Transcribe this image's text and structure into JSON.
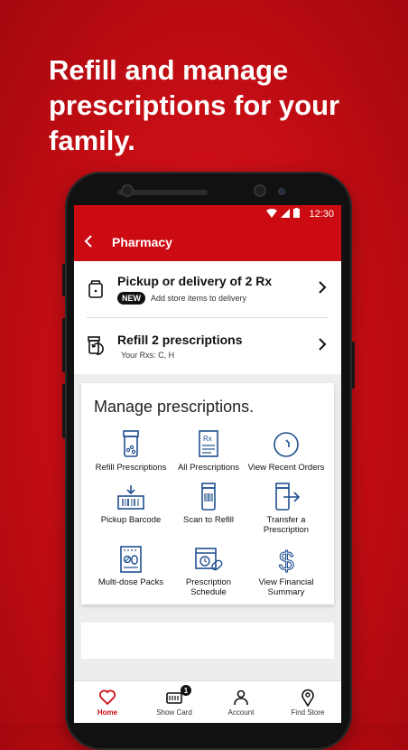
{
  "headline": "Refill and manage prescriptions for your family.",
  "status_bar": {
    "time": "12:30"
  },
  "app_bar": {
    "title": "Pharmacy",
    "back_icon": "chevron-left-icon"
  },
  "rx_actions": [
    {
      "title": "Pickup or delivery of 2 Rx",
      "badge": "NEW",
      "subtitle": "Add store items to delivery",
      "icon": "bag-icon"
    },
    {
      "title": "Refill 2 prescriptions",
      "subtitle": "Your Rxs: C, H",
      "icon": "refill-bottle-icon"
    }
  ],
  "manage": {
    "title": "Manage prescriptions.",
    "tiles": [
      {
        "label": "Refill Prescriptions",
        "icon": "pill-bottle-icon"
      },
      {
        "label": "All Prescriptions",
        "icon": "rx-document-icon"
      },
      {
        "label": "View Recent Orders",
        "icon": "clock-icon"
      },
      {
        "label": "Pickup Barcode",
        "icon": "barcode-icon"
      },
      {
        "label": "Scan to Refill",
        "icon": "scan-bottle-icon"
      },
      {
        "label": "Transfer a Prescription",
        "icon": "transfer-icon"
      },
      {
        "label": "Multi-dose Packs",
        "icon": "pill-pack-icon"
      },
      {
        "label": "Prescription Schedule",
        "icon": "schedule-icon"
      },
      {
        "label": "View Financial Summary",
        "icon": "dollar-icon"
      }
    ]
  },
  "tabs": [
    {
      "label": "Home",
      "icon": "heart-icon",
      "active": true
    },
    {
      "label": "Show Card",
      "icon": "card-icon",
      "badge": "1"
    },
    {
      "label": "Account",
      "icon": "person-icon"
    },
    {
      "label": "Find Store",
      "icon": "location-pin-icon"
    }
  ],
  "colors": {
    "brand": "#cc0a12",
    "icon_blue": "#1f4f8f",
    "text": "#111111"
  }
}
